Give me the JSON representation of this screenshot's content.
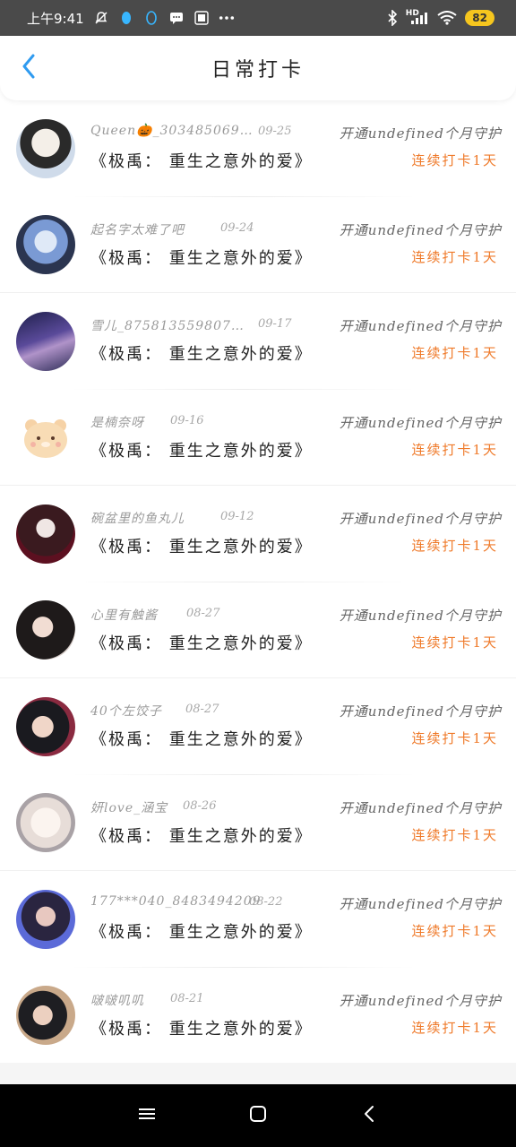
{
  "status_bar": {
    "time": "上午9:41",
    "battery": "82",
    "hd_label": "HD"
  },
  "header": {
    "title": "日常打卡"
  },
  "entries": [
    {
      "user": "Queen🎃_303485069…",
      "date": "09-25",
      "guard": "开通undefined个月守护",
      "book": "《极禹： 重生之意外的爱》",
      "streak": "连续打卡1天"
    },
    {
      "user": "起名字太难了吧",
      "date": "09-24",
      "guard": "开通undefined个月守护",
      "book": "《极禹： 重生之意外的爱》",
      "streak": "连续打卡1天"
    },
    {
      "user": "雪儿_875813559807…",
      "date": "09-17",
      "guard": "开通undefined个月守护",
      "book": "《极禹： 重生之意外的爱》",
      "streak": "连续打卡1天"
    },
    {
      "user": "是楠奈呀",
      "date": "09-16",
      "guard": "开通undefined个月守护",
      "book": "《极禹： 重生之意外的爱》",
      "streak": "连续打卡1天"
    },
    {
      "user": "碗盆里的鱼丸儿",
      "date": "09-12",
      "guard": "开通undefined个月守护",
      "book": "《极禹： 重生之意外的爱》",
      "streak": "连续打卡1天"
    },
    {
      "user": "心里有触酱",
      "date": "08-27",
      "guard": "开通undefined个月守护",
      "book": "《极禹： 重生之意外的爱》",
      "streak": "连续打卡1天"
    },
    {
      "user": "40个左饺子",
      "date": "08-27",
      "guard": "开通undefined个月守护",
      "book": "《极禹： 重生之意外的爱》",
      "streak": "连续打卡1天"
    },
    {
      "user": "妍love_涵宝",
      "date": "08-26",
      "guard": "开通undefined个月守护",
      "book": "《极禹： 重生之意外的爱》",
      "streak": "连续打卡1天"
    },
    {
      "user": "177***040_8483494209",
      "date": "08-22",
      "guard": "开通undefined个月守护",
      "book": "《极禹： 重生之意外的爱》",
      "streak": "连续打卡1天"
    },
    {
      "user": "啵啵叽叽",
      "date": "08-21",
      "guard": "开通undefined个月守护",
      "book": "《极禹： 重生之意外的爱》",
      "streak": "连续打卡1天"
    }
  ],
  "colors": {
    "accent": "#2f9bf0",
    "streak": "#ef7a2a"
  }
}
